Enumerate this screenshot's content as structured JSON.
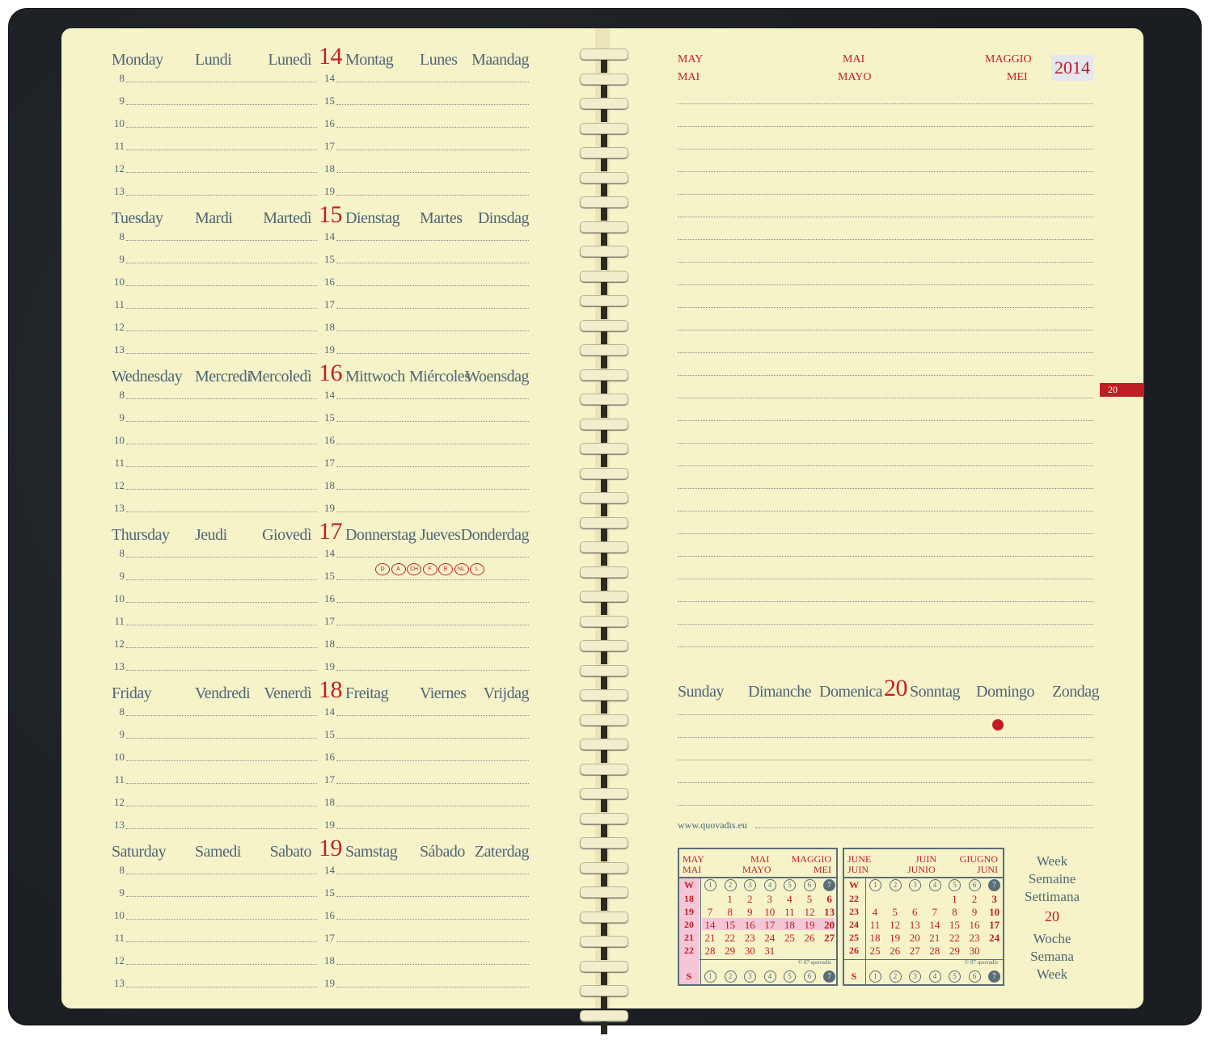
{
  "days": [
    {
      "names": [
        "Monday",
        "Lundi",
        "Lunedì"
      ],
      "num": "14",
      "names2": [
        "Montag",
        "Lunes",
        "Maandag"
      ]
    },
    {
      "names": [
        "Tuesday",
        "Mardi",
        "Martedì"
      ],
      "num": "15",
      "names2": [
        "Dienstag",
        "Martes",
        "Dinsdag"
      ]
    },
    {
      "names": [
        "Wednesday",
        "Mercredi",
        "Mercoledì"
      ],
      "num": "16",
      "names2": [
        "Mittwoch",
        "Miércoles",
        "Woensdag"
      ]
    },
    {
      "names": [
        "Thursday",
        "Jeudi",
        "Giovedì"
      ],
      "num": "17",
      "names2": [
        "Donnerstag",
        "Jueves",
        "Donderdag"
      ]
    },
    {
      "names": [
        "Friday",
        "Vendredi",
        "Venerdì"
      ],
      "num": "18",
      "names2": [
        "Freitag",
        "Viernes",
        "Vrijdag"
      ]
    },
    {
      "names": [
        "Saturday",
        "Samedi",
        "Sabato"
      ],
      "num": "19",
      "names2": [
        "Samstag",
        "Sábado",
        "Zaterdag"
      ]
    }
  ],
  "hours_left": [
    "8",
    "9",
    "10",
    "11",
    "12",
    "13"
  ],
  "hours_right": [
    "14",
    "15",
    "16",
    "17",
    "18",
    "19"
  ],
  "holiday_countries": [
    "D",
    "A",
    "CH",
    "F",
    "B",
    "NL",
    "L"
  ],
  "right_header": {
    "may": "MAY",
    "mai": "MAI",
    "mai2": "MAI",
    "mayo": "MAYO",
    "maggio": "MAGGIO",
    "mei": "MEI",
    "year": "2014"
  },
  "week_tab": "20",
  "sunday": {
    "names": [
      "Sunday",
      "Dimanche",
      "Domenica"
    ],
    "num": "20",
    "names2": [
      "Sonntag",
      "Domingo",
      "Zondag"
    ]
  },
  "url": "www.quovadis.eu",
  "mini_may": {
    "head": [
      "MAY",
      "MAI",
      "MAI",
      "MAYO",
      "MAGGIO",
      "MEI"
    ],
    "weeks": [
      "18",
      "19",
      "20",
      "21",
      "22"
    ],
    "rows": [
      [
        "",
        "",
        "1",
        "2",
        "3",
        "4"
      ],
      [
        "5",
        "6",
        "7",
        "8",
        "9",
        "10"
      ]
    ],
    "grid": [
      [
        "",
        "1",
        "2",
        "3",
        "4",
        "6"
      ],
      [
        "7",
        "8",
        "9",
        "10",
        "11",
        "12"
      ]
    ],
    "cal": [
      [
        "",
        "",
        "1",
        "2",
        "3",
        "4",
        "5"
      ],
      [
        "6",
        "7",
        "8",
        "9",
        "10",
        "11",
        "12"
      ]
    ],
    "lines": [
      [
        "",
        "",
        "1",
        "2",
        "3",
        "4",
        "",
        "6"
      ],
      [],
      []
    ],
    "table": [
      [
        "",
        "",
        "",
        "1",
        "2",
        "3",
        "4",
        "5",
        "6"
      ]
    ],
    "data": [
      [
        "",
        "",
        "1",
        "2",
        "3",
        "4"
      ],
      [
        "",
        "",
        "",
        "",
        "",
        ""
      ]
    ],
    "dates": [
      [
        "",
        "",
        "1",
        "2",
        "3",
        "4",
        "5"
      ]
    ],
    "weekrows": [
      {
        "w": "18",
        "d": [
          "",
          "",
          "1",
          "2",
          "3",
          "4",
          "5"
        ],
        "sun": "6"
      }
    ],
    "body": [
      {
        "w": "18",
        "d": [
          "",
          "1",
          "2",
          "3",
          "4",
          "5"
        ],
        "s": "6"
      },
      {
        "w": "19",
        "d": [
          "7",
          "8",
          "9",
          "10",
          "11",
          "12"
        ],
        "s": "13"
      },
      {
        "w": "20",
        "d": [
          "14",
          "15",
          "16",
          "17",
          "18",
          "19"
        ],
        "s": "20"
      },
      {
        "w": "21",
        "d": [
          "21",
          "22",
          "23",
          "24",
          "25",
          "26"
        ],
        "s": "27"
      },
      {
        "w": "22",
        "d": [
          "28",
          "29",
          "30",
          "31",
          "",
          ""
        ],
        "s": ""
      }
    ],
    "credit": "© 87 quovadis"
  },
  "mini_june": {
    "head": [
      "JUNE",
      "JUIN",
      "JUIN",
      "JUNIO",
      "GIUGNO",
      "JUNI"
    ],
    "body": [
      {
        "w": "22",
        "d": [
          "",
          "",
          "",
          "",
          "1",
          "2"
        ],
        "s": "3"
      },
      {
        "w": "23",
        "d": [
          "4",
          "5",
          "6",
          "7",
          "8",
          "9"
        ],
        "s": "10"
      },
      {
        "w": "24",
        "d": [
          "11",
          "12",
          "13",
          "14",
          "15",
          "16"
        ],
        "s": "17"
      },
      {
        "w": "25",
        "d": [
          "18",
          "19",
          "20",
          "21",
          "22",
          "23"
        ],
        "s": "24"
      },
      {
        "w": "26",
        "d": [
          "25",
          "26",
          "27",
          "28",
          "29",
          "30"
        ],
        "s": ""
      }
    ],
    "credit": "© 87 quovadis"
  },
  "mini_labels": {
    "w": "W",
    "s": "S",
    "dow": [
      "1",
      "2",
      "3",
      "4",
      "5",
      "6",
      "7"
    ]
  },
  "week_label": {
    "lines1": [
      "Week",
      "Semaine",
      "Settimana"
    ],
    "num": "20",
    "lines2": [
      "Woche",
      "Semana",
      "Week"
    ]
  },
  "colors": {
    "red": "#c01e25",
    "blue_grey": "#4e6676",
    "paper": "#f6f3c9"
  }
}
